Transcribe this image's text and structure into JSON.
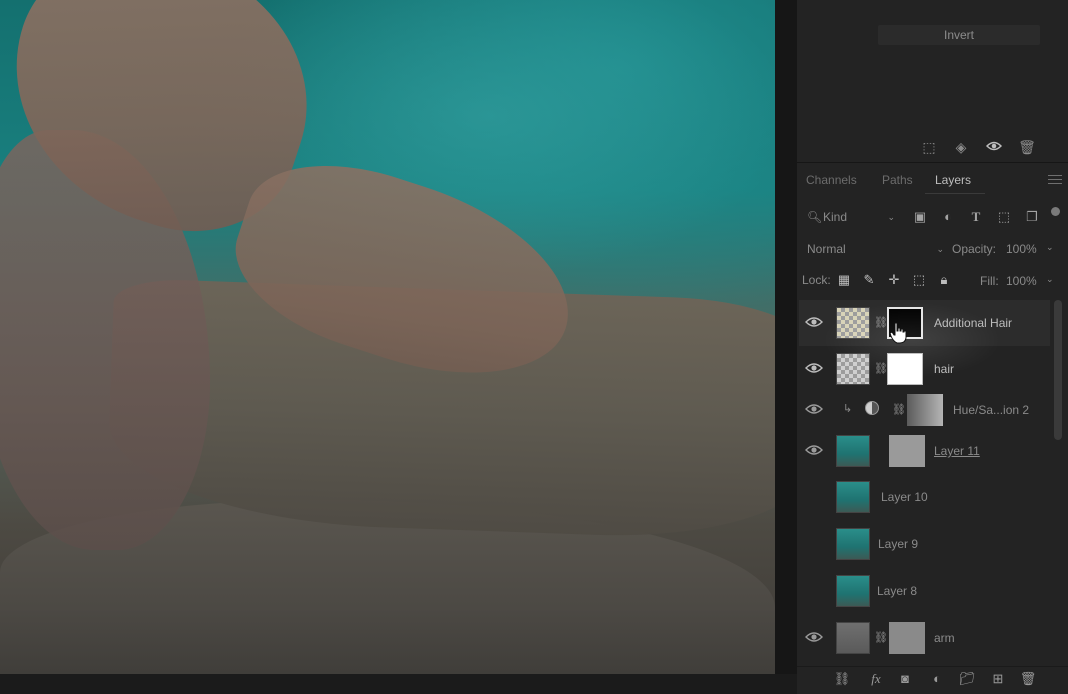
{
  "properties": {
    "invert_label": "Invert"
  },
  "panel_tabs": [
    {
      "label": "Channels",
      "active": false
    },
    {
      "label": "Paths",
      "active": false
    },
    {
      "label": "Layers",
      "active": true
    }
  ],
  "filter": {
    "kind_label": "Kind",
    "icons": [
      "image-filter-icon",
      "adjustment-filter-icon",
      "type-filter-icon",
      "shape-filter-icon",
      "smart-object-filter-icon"
    ]
  },
  "blend": {
    "mode": "Normal",
    "opacity_label": "Opacity:",
    "opacity_value": "100%"
  },
  "lock": {
    "label": "Lock:",
    "fill_label": "Fill:",
    "fill_value": "100%",
    "icons": [
      "lock-transparent-icon",
      "lock-image-icon",
      "lock-position-icon",
      "lock-artboard-icon",
      "lock-all-icon"
    ]
  },
  "layers": [
    {
      "name": "Additional Hair",
      "visible": true,
      "selected": true
    },
    {
      "name": "hair",
      "visible": true,
      "selected": false
    },
    {
      "name": "Hue/Sa...ion 2",
      "visible": true,
      "selected": false
    },
    {
      "name": "Layer 11",
      "visible": true,
      "selected": false
    },
    {
      "name": "Layer 10",
      "visible": false,
      "selected": false
    },
    {
      "name": "Layer 9",
      "visible": false,
      "selected": false
    },
    {
      "name": "Layer 8",
      "visible": false,
      "selected": false
    },
    {
      "name": "arm",
      "visible": true,
      "selected": false
    }
  ],
  "colors": {
    "panel_bg": "#232323",
    "selected_row": "#2c2c2c",
    "text": "#bdbdbd"
  }
}
